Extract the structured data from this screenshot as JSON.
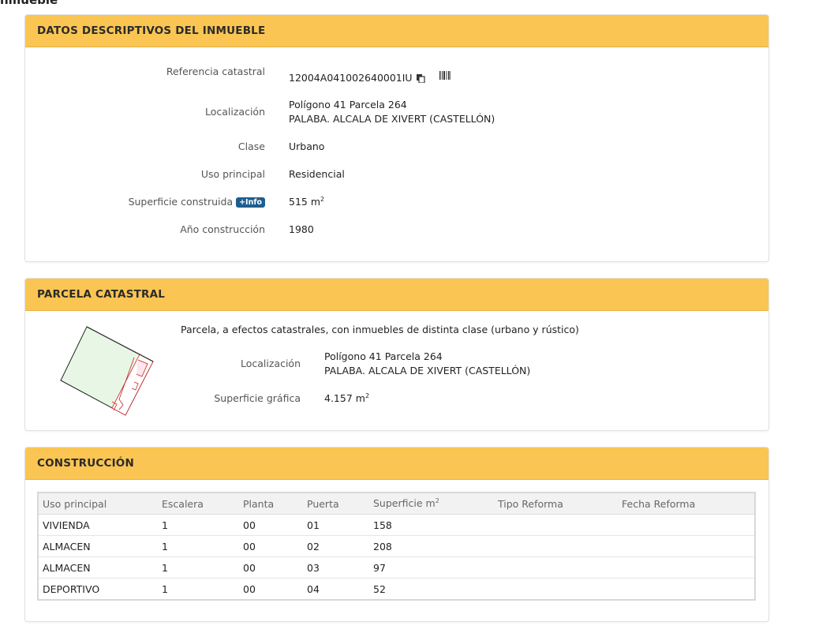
{
  "page": {
    "cut_title": "nmueble"
  },
  "datos": {
    "title": "DATOS DESCRIPTIVOS DEL INMUEBLE",
    "ref_label": "Referencia catastral",
    "ref_value": "12004A041002640001IU",
    "loc_label": "Localización",
    "loc_line1": "Polígono 41 Parcela 264",
    "loc_line2": "PALABA. ALCALA DE XIVERT (CASTELLÓN)",
    "clase_label": "Clase",
    "clase_value": "Urbano",
    "uso_label": "Uso principal",
    "uso_value": "Residencial",
    "sup_label": "Superficie construida",
    "sup_badge": "+Info",
    "sup_value": "515 m",
    "sup_exp": "2",
    "anio_label": "Año construcción",
    "anio_value": "1980"
  },
  "parcela": {
    "title": "PARCELA CATASTRAL",
    "desc": "Parcela, a efectos catastrales, con inmuebles de distinta clase (urbano y rústico)",
    "loc_label": "Localización",
    "loc_line1": "Polígono 41 Parcela 264",
    "loc_line2": "PALABA. ALCALA DE XIVERT (CASTELLÓN)",
    "sup_label": "Superficie gráfica",
    "sup_value": "4.157 m",
    "sup_exp": "2"
  },
  "construccion": {
    "title": "CONSTRUCCIÓN",
    "headers": [
      "Uso principal",
      "Escalera",
      "Planta",
      "Puerta",
      "Superficie m",
      "Tipo Reforma",
      "Fecha Reforma"
    ],
    "sup_exp": "2",
    "rows": [
      [
        "VIVIENDA",
        "1",
        "00",
        "01",
        "158",
        "",
        ""
      ],
      [
        "ALMACEN",
        "1",
        "00",
        "02",
        "208",
        "",
        ""
      ],
      [
        "ALMACEN",
        "1",
        "00",
        "03",
        "97",
        "",
        ""
      ],
      [
        "DEPORTIVO",
        "1",
        "00",
        "04",
        "52",
        "",
        ""
      ]
    ]
  },
  "icons": {
    "copy": "copy-icon",
    "barcode": "barcode-icon",
    "parcel_map": "parcel-map-icon"
  }
}
